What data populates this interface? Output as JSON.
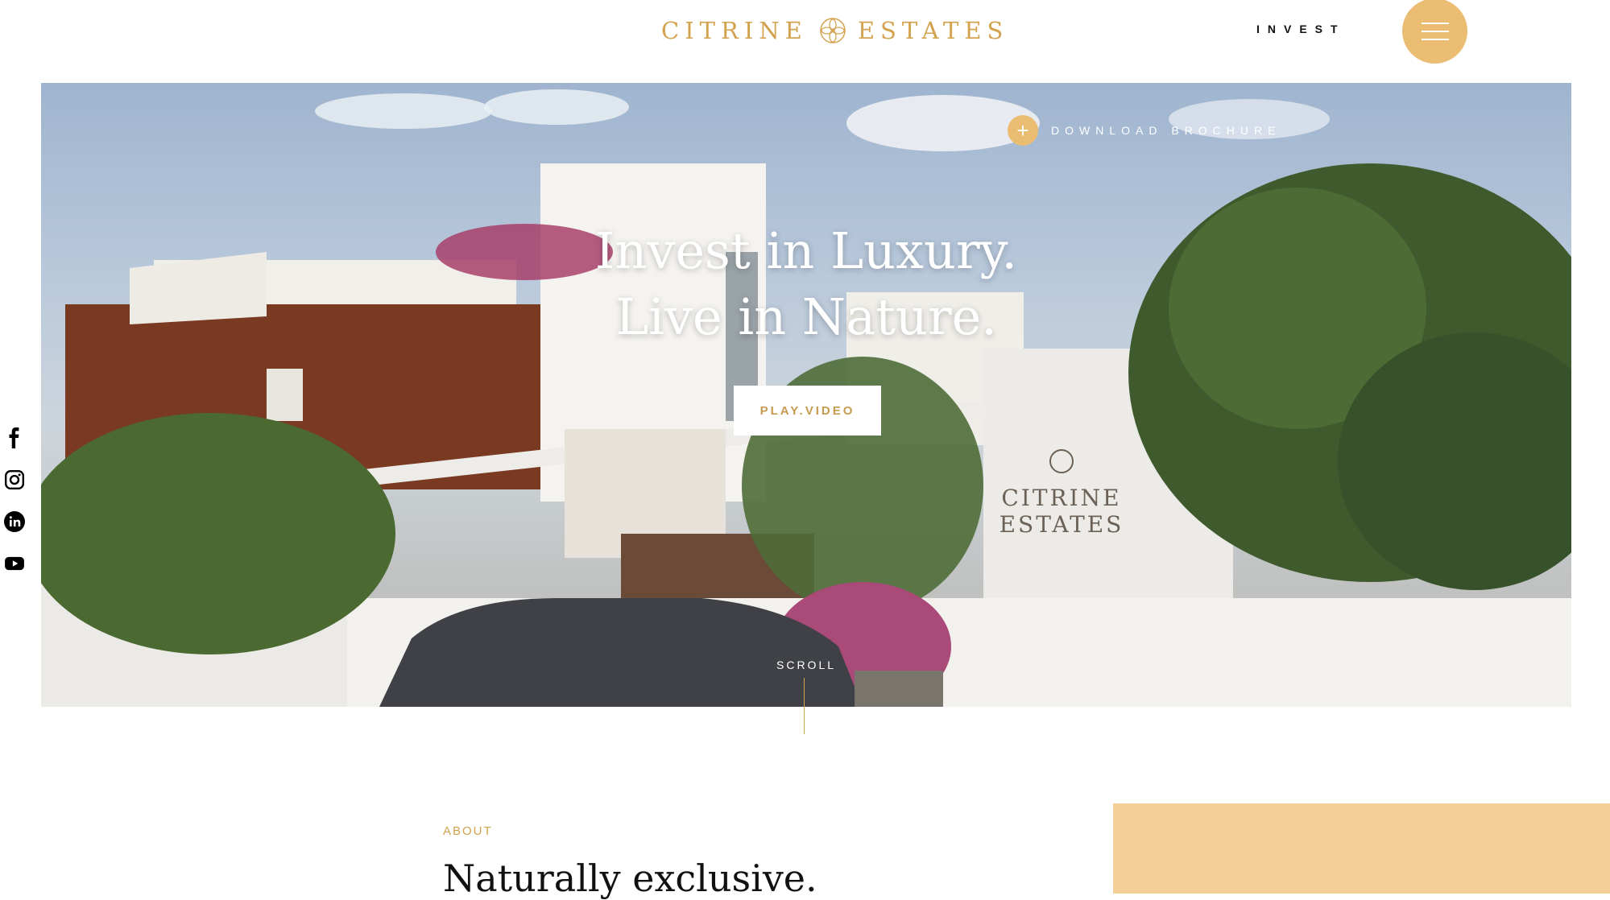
{
  "header": {
    "logo_left": "CITRINE",
    "logo_right": "ESTATES",
    "logo_icon": "flower-emblem-icon",
    "nav_invest": "INVEST",
    "menu_icon": "hamburger-menu-icon"
  },
  "social": [
    {
      "name": "facebook",
      "icon": "facebook-icon"
    },
    {
      "name": "instagram",
      "icon": "instagram-icon"
    },
    {
      "name": "linkedin",
      "icon": "linkedin-icon"
    },
    {
      "name": "youtube",
      "icon": "youtube-icon"
    }
  ],
  "hero": {
    "brochure_label": "DOWNLOAD BROCHURE",
    "brochure_icon": "plus-icon",
    "headline_line1": "Invest in Luxury.",
    "headline_line2": "Live in Nature.",
    "play_label": "PLAY.VIDEO",
    "scroll_label": "SCROLL",
    "sign_line1": "CITRINE",
    "sign_line2": "ESTATES"
  },
  "about": {
    "label": "ABOUT",
    "title": "Naturally exclusive."
  },
  "colors": {
    "accent": "#ebbd73",
    "gold_text": "#d2a24f",
    "about_box": "#f2d098"
  }
}
